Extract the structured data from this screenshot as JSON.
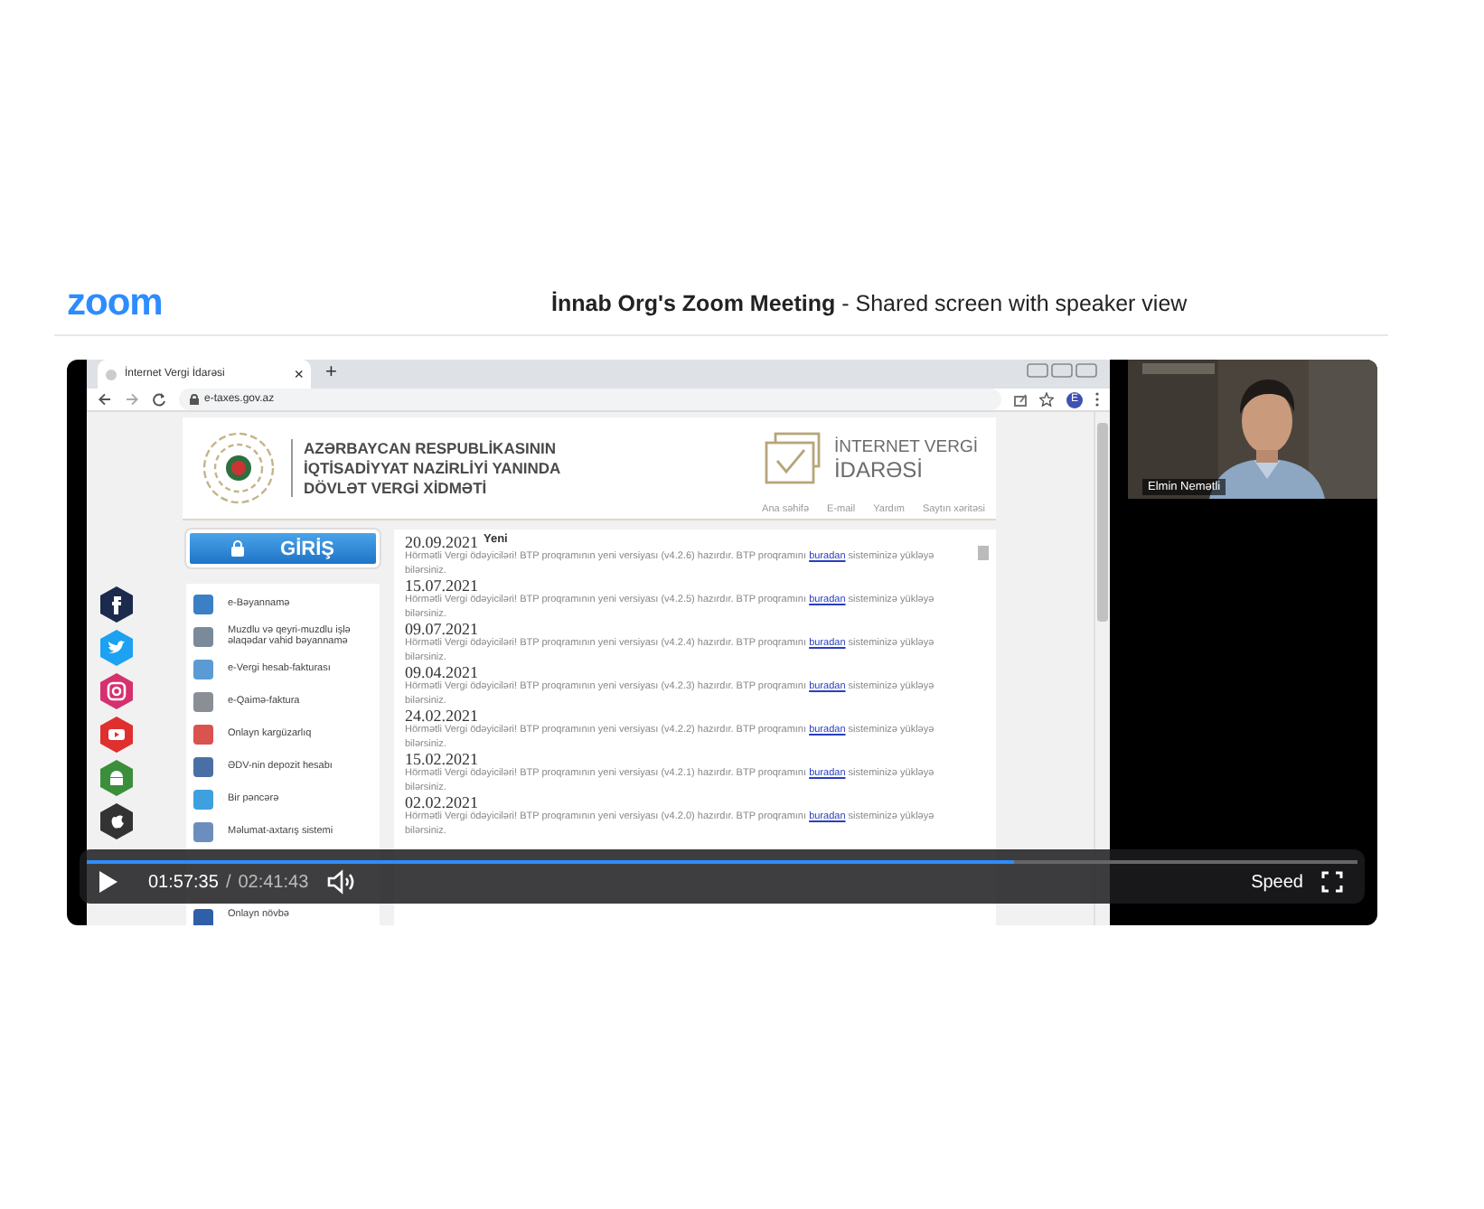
{
  "app": {
    "logo": "zoom",
    "title": "**İnnab Org's Zoom Meeting** - Shared screen with speaker view"
  },
  "shared_screen": {
    "browser": {
      "tab_title": "İnternet Vergi İdarəsi",
      "tab_close": "×",
      "new_tab": "+",
      "url": "e-taxes.gov.az",
      "profile_initial": "E"
    },
    "site": {
      "org_lines": [
        "AZƏRBAYCAN RESPUBLİKASININ",
        "İQTİSADİYYAT NAZİRLİYİ YANINDA",
        "DÖVLƏT VERGİ XİDMƏTİ"
      ],
      "service_title": [
        "İNTERNET VERGİ",
        "İDARƏSİ"
      ],
      "nav_links": [
        "Ana səhifə",
        "E-mail",
        "Yardım",
        "Saytın xəritəsi"
      ],
      "login_label": "GİRİŞ",
      "menu": [
        {
          "label": "e-Bəyannamə",
          "color": "#3b7fc4"
        },
        {
          "label": "Muzdlu və qeyri-muzdlu işlə əlaqədar vahid bəyannamə",
          "color": "#7a8a99"
        },
        {
          "label": "e-Vergi hesab-fakturası",
          "color": "#5b9bd5"
        },
        {
          "label": "e-Qaimə-faktura",
          "color": "#8a8f96"
        },
        {
          "label": "Onlayn kargüzarlıq",
          "color": "#d9534f"
        },
        {
          "label": "ƏDV-nin depozit hesabı",
          "color": "#4a6fa5"
        },
        {
          "label": "Bir pəncərə",
          "color": "#3fa0e0"
        },
        {
          "label": "Məlumat-axtarış sistemi",
          "color": "#6c8ebf"
        },
        {
          "label": "Onlayn növbə",
          "color": "#2f5fa8"
        }
      ],
      "news_badge": "Yeni",
      "news": [
        {
          "date": "20.09.2021",
          "text_before": "Hörmətli Vergi ödəyiciləri! BTP proqramının yeni versiyası (v4.2.6) hazırdır. BTP proqramını",
          "link": "buradan",
          "text_after": "sisteminizə yükləyə bilərsiniz."
        },
        {
          "date": "15.07.2021",
          "text_before": "Hörmətli Vergi ödəyiciləri! BTP proqramının yeni versiyası (v4.2.5) hazırdır. BTP proqramını",
          "link": "buradan",
          "text_after": "sisteminizə yükləyə bilərsiniz."
        },
        {
          "date": "09.07.2021",
          "text_before": "Hörmətli Vergi ödəyiciləri! BTP proqramının yeni versiyası (v4.2.4) hazırdır. BTP proqramını",
          "link": "buradan",
          "text_after": "sisteminizə yükləyə bilərsiniz."
        },
        {
          "date": "09.04.2021",
          "text_before": "Hörmətli Vergi ödəyiciləri! BTP proqramının yeni versiyası (v4.2.3) hazırdır. BTP proqramını",
          "link": "buradan",
          "text_after": "sisteminizə yükləyə bilərsiniz."
        },
        {
          "date": "24.02.2021",
          "text_before": "Hörmətli Vergi ödəyiciləri! BTP proqramının yeni versiyası (v4.2.2) hazırdır. BTP proqramını",
          "link": "buradan",
          "text_after": "sisteminizə yükləyə bilərsiniz."
        },
        {
          "date": "15.02.2021",
          "text_before": "Hörmətli Vergi ödəyiciləri! BTP proqramının yeni versiyası (v4.2.1) hazırdır. BTP proqramını",
          "link": "buradan",
          "text_after": "sisteminizə yükləyə bilərsiniz."
        },
        {
          "date": "02.02.2021",
          "text_before": "Hörmətli Vergi ödəyiciləri! BTP proqramının yeni versiyası (v4.2.0) hazırdır. BTP proqramını",
          "link": "buradan",
          "text_after": "sisteminizə yükləyə bilərsiniz."
        }
      ]
    }
  },
  "speaker": {
    "name": "Elmin Nemətli"
  },
  "player": {
    "playing": false,
    "progress": {
      "level": 0.73
    },
    "elapsed": "01:57:35",
    "separator": "/",
    "duration": "02:41:43",
    "speed_label": "Speed"
  }
}
